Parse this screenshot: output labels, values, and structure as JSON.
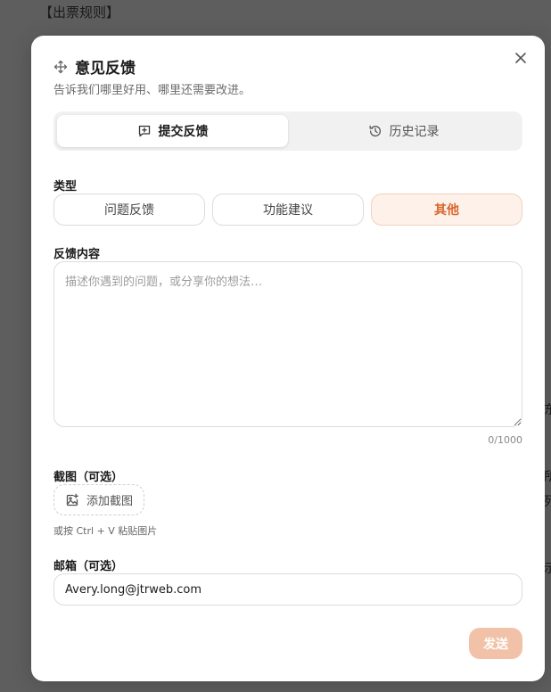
{
  "background": {
    "heading": "【出票规则】",
    "fragments": [
      "东",
      "所",
      "列",
      "示"
    ]
  },
  "modal": {
    "title": "意见反馈",
    "subtitle": "告诉我们哪里好用、哪里还需要改进。",
    "close_icon": "close-icon",
    "tabs": [
      {
        "label": "提交反馈",
        "icon": "feedback-plus-icon",
        "active": true
      },
      {
        "label": "历史记录",
        "icon": "history-icon",
        "active": false
      }
    ],
    "type_section": {
      "label": "类型",
      "options": [
        {
          "label": "问题反馈",
          "selected": false
        },
        {
          "label": "功能建议",
          "selected": false
        },
        {
          "label": "其他",
          "selected": true
        }
      ]
    },
    "content_section": {
      "label": "反馈内容",
      "placeholder": "描述你遇到的问题，或分享你的想法…",
      "value": "",
      "counter": "0/1000"
    },
    "screenshot_section": {
      "label": "截图（可选）",
      "add_button": "添加截图",
      "hint": "或按 Ctrl + V 粘贴图片"
    },
    "email_section": {
      "label": "邮箱（可选）",
      "value": "Avery.long@jtrweb.com"
    },
    "send_button": "发送"
  },
  "colors": {
    "accent": "#d9662d",
    "accent_bg": "#fdf1ea",
    "send_disabled": "#f2c2a8",
    "overlay": "#5e5e5e"
  }
}
